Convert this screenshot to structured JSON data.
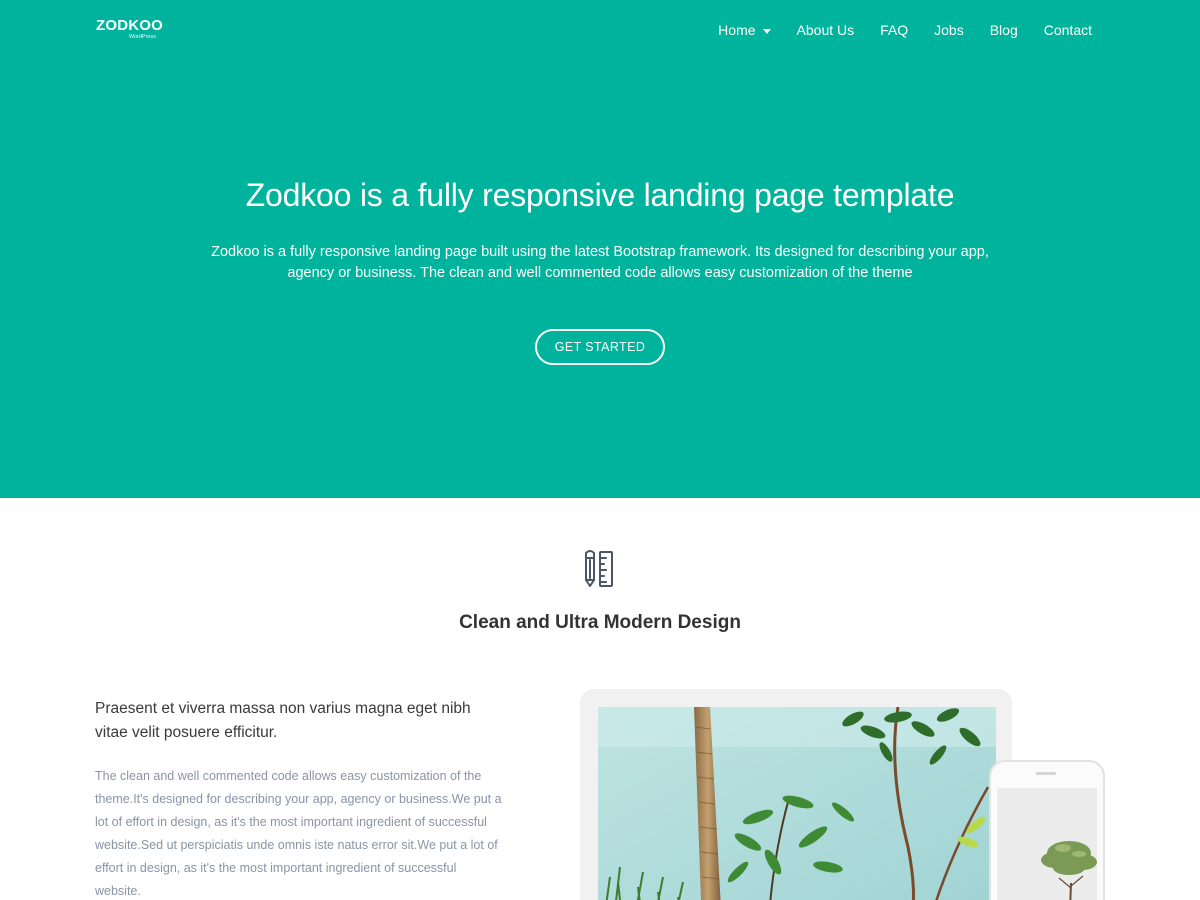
{
  "brand": {
    "logo_main": "ZODKOO",
    "logo_sub": "WordPress"
  },
  "nav": {
    "items": [
      {
        "label": "Home",
        "has_dropdown": true
      },
      {
        "label": "About Us"
      },
      {
        "label": "FAQ"
      },
      {
        "label": "Jobs"
      },
      {
        "label": "Blog"
      },
      {
        "label": "Contact"
      }
    ]
  },
  "hero": {
    "title": "Zodkoo is a fully responsive landing page template",
    "description_line1": "Zodkoo is a fully responsive landing page built using the latest Bootstrap framework. Its designed for describing your app,",
    "description_line2": "agency or business. The clean and well commented code allows easy customization of the theme",
    "button_label": "GET STARTED"
  },
  "feature": {
    "icon": "pencil-ruler-icon",
    "title": "Clean and Ultra Modern Design",
    "lead": "Praesent et viverra massa non varius magna eget nibh vitae velit posuere efficitur.",
    "body": "The clean and well commented code allows easy customization of the theme.It's designed for describing your app, agency or business.We put a lot of effort in design, as it's the most important ingredient of successful website.Sed ut perspiciatis unde omnis iste natus error sit.We put a lot of effort in design, as it's the most important ingredient of successful website."
  },
  "colors": {
    "accent": "#00b39c",
    "heading": "#333333",
    "muted_text": "#8a94a6"
  }
}
